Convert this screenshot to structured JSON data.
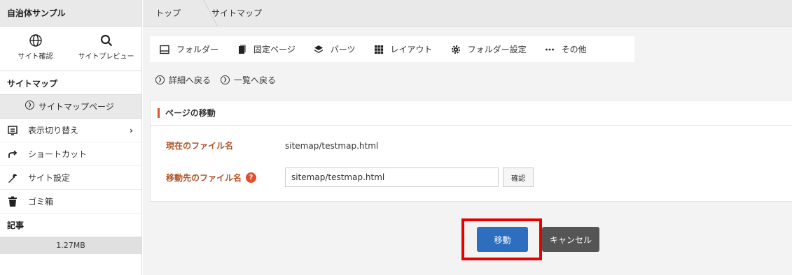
{
  "sidebar": {
    "title": "自治体サンプル",
    "tools": [
      {
        "label": "サイト確認",
        "icon": "globe-icon"
      },
      {
        "label": "サイトプレビュー",
        "icon": "search-icon"
      }
    ],
    "section_title": "サイトマップ",
    "sub_item": "サイトマップページ",
    "items": [
      {
        "label": "表示切り替え",
        "icon": "display-switch-icon"
      },
      {
        "label": "ショートカット",
        "icon": "shortcut-arrow-icon"
      },
      {
        "label": "サイト設定",
        "icon": "wrench-icon"
      },
      {
        "label": "ゴミ箱",
        "icon": "trash-icon"
      }
    ],
    "articles_title": "記事",
    "usage": "1.27MB"
  },
  "breadcrumb": [
    "トップ",
    "サイトマップ"
  ],
  "toolbar": [
    {
      "label": "フォルダー",
      "icon": "folder-icon"
    },
    {
      "label": "固定ページ",
      "icon": "page-icon"
    },
    {
      "label": "パーツ",
      "icon": "layers-icon"
    },
    {
      "label": "レイアウト",
      "icon": "grid-icon"
    },
    {
      "label": "フォルダー設定",
      "icon": "gear-icon"
    },
    {
      "label": "その他",
      "icon": "more-icon"
    }
  ],
  "backlinks": [
    "詳細へ戻る",
    "一覧へ戻る"
  ],
  "panel": {
    "title": "ページの移動",
    "current_label": "現在のファイル名",
    "current_value": "sitemap/testmap.html",
    "dest_label": "移動先のファイル名",
    "dest_value": "sitemap/testmap.html",
    "check_button": "確認"
  },
  "buttons": {
    "move": "移動",
    "cancel": "キャンセル"
  },
  "colors": {
    "accent": "#e0502a",
    "primary": "#2d6fbe",
    "highlight": "#e60000"
  }
}
